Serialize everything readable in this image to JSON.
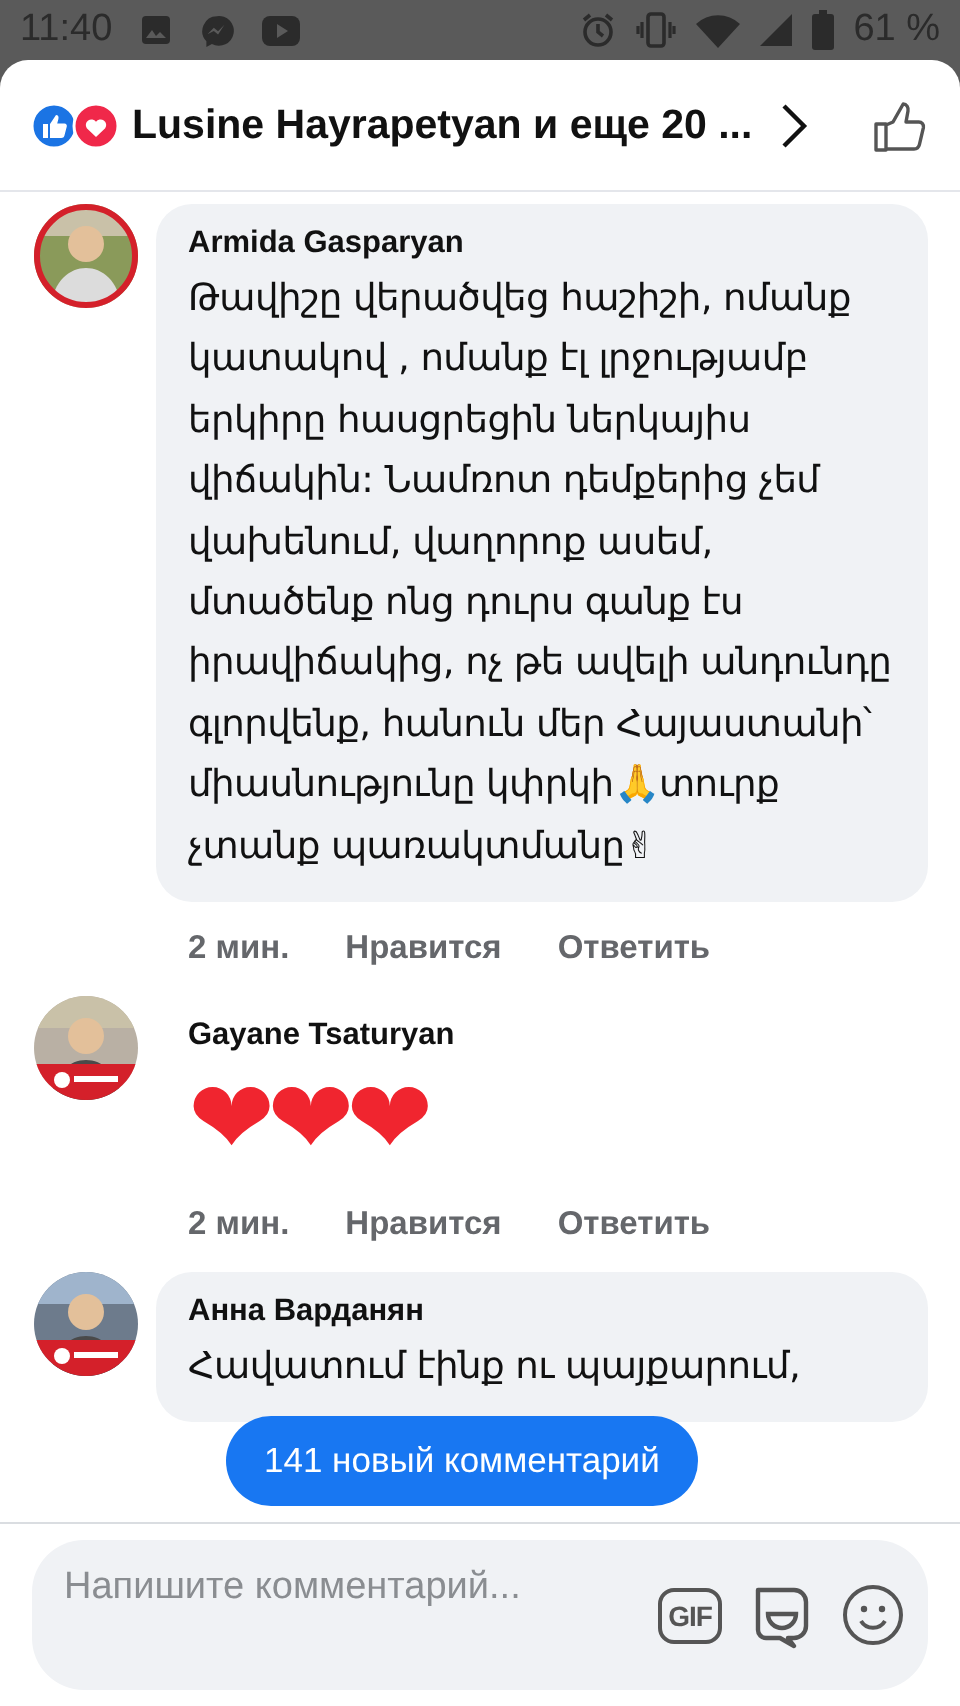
{
  "status_bar": {
    "time": "11:40",
    "battery_text": "61 %"
  },
  "header": {
    "title": "Lusine Hayrapetyan и еще 20 ..."
  },
  "comments": [
    {
      "kind": "bubble",
      "author": "Armida Gasparyan",
      "text": "Թավիշը վերածվեց հաշիշի, ոմանք կատակով , ոմանք էլ լրջությամբ երկիրը հասցրեցին ներկայիս վիճակին: Նամռոտ դեմքերից չեմ վախենում, վաղորոք ասեմ, մտածենք ոնց դուրս գանք էս իրավիճակից, ոչ թե ավելի անդունդը գլորվենք, հանուն մեր Հայաստանի՝ միասնությունը կփրկի🙏տուրք չտանք պառակտմանը✌",
      "time": "2 мин.",
      "like": "Нравится",
      "reply": "Ответить"
    },
    {
      "kind": "emoji",
      "author": "Gayane Tsaturyan",
      "text": "❤❤❤",
      "time": "2 мин.",
      "like": "Нравится",
      "reply": "Ответить"
    },
    {
      "kind": "bubble",
      "author": "Анна Варданян",
      "text": "Հավատում էինք ու պայքարում,"
    }
  ],
  "new_comments_button": "141 новый комментарий",
  "composer": {
    "placeholder": "Напишите комментарий...",
    "gif_label": "GIF"
  }
}
